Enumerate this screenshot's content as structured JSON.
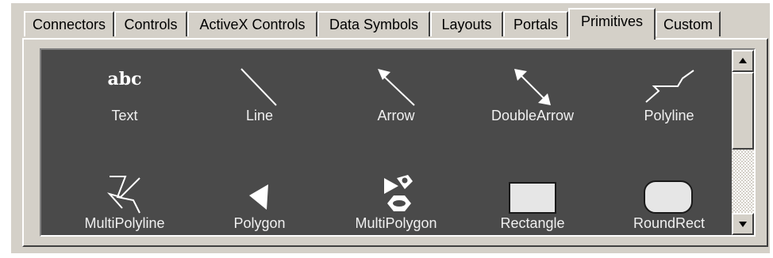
{
  "tabs": [
    {
      "label": "Connectors",
      "active": false
    },
    {
      "label": "Controls",
      "active": false
    },
    {
      "label": "ActiveX Controls",
      "active": false
    },
    {
      "label": "Data Symbols",
      "active": false
    },
    {
      "label": "Layouts",
      "active": false
    },
    {
      "label": "Portals",
      "active": false
    },
    {
      "label": "Primitives",
      "active": true
    },
    {
      "label": "Custom",
      "active": false
    }
  ],
  "palette": {
    "items": [
      {
        "label": "Text",
        "icon": "text-abc-icon",
        "glyph_text": "abc"
      },
      {
        "label": "Line",
        "icon": "line-icon"
      },
      {
        "label": "Arrow",
        "icon": "arrow-icon"
      },
      {
        "label": "DoubleArrow",
        "icon": "double-arrow-icon"
      },
      {
        "label": "Polyline",
        "icon": "polyline-icon"
      },
      {
        "label": "MultiPolyline",
        "icon": "multi-polyline-icon"
      },
      {
        "label": "Polygon",
        "icon": "polygon-icon"
      },
      {
        "label": "MultiPolygon",
        "icon": "multi-polygon-icon"
      },
      {
        "label": "Rectangle",
        "icon": "rectangle-icon"
      },
      {
        "label": "RoundRect",
        "icon": "round-rect-icon"
      }
    ],
    "background_color": "#4a4a4a"
  },
  "scrollbar": {
    "up_icon": "scroll-up-arrow-icon",
    "down_icon": "scroll-down-arrow-icon"
  }
}
